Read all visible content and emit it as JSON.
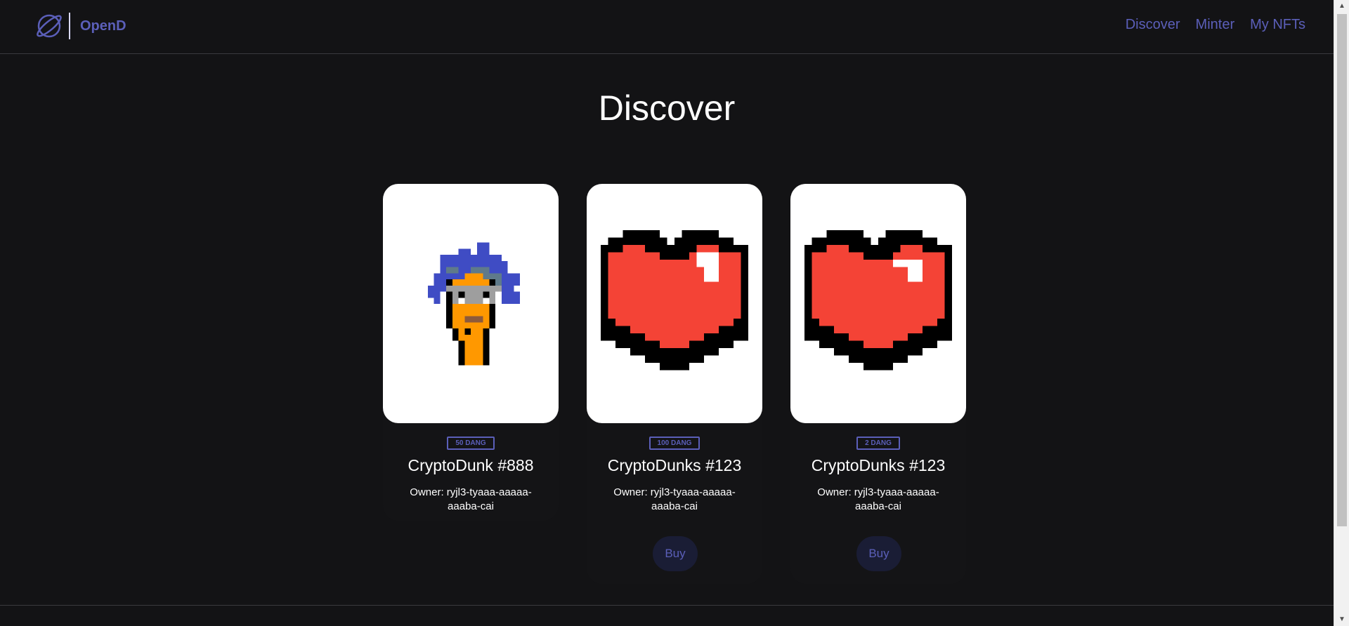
{
  "header": {
    "brand": "OpenD",
    "nav": [
      "Discover",
      "Minter",
      "My NFTs"
    ]
  },
  "page": {
    "title": "Discover"
  },
  "nfts": [
    {
      "image": "cryptopunk-pixel-art",
      "price": "50 DANG",
      "name": "CryptoDunk #888",
      "owner": "Owner: ryjl3-tyaaa-aaaaa-aaaba-cai",
      "buy_label": null
    },
    {
      "image": "pixel-heart",
      "price": "100 DANG",
      "name": "CryptoDunks #123",
      "owner": "Owner: ryjl3-tyaaa-aaaaa-aaaba-cai",
      "buy_label": "Buy"
    },
    {
      "image": "pixel-heart",
      "price": "2 DANG",
      "name": "CryptoDunks #123",
      "owner": "Owner: ryjl3-tyaaa-aaaaa-aaaba-cai",
      "buy_label": "Buy"
    }
  ],
  "colors": {
    "background": "#131315",
    "accent": "#5b5fb9",
    "button_bg": "#1a1d35",
    "heart_red": "#f44336"
  },
  "scrollbar": {
    "up": "▲",
    "down": "▼"
  }
}
